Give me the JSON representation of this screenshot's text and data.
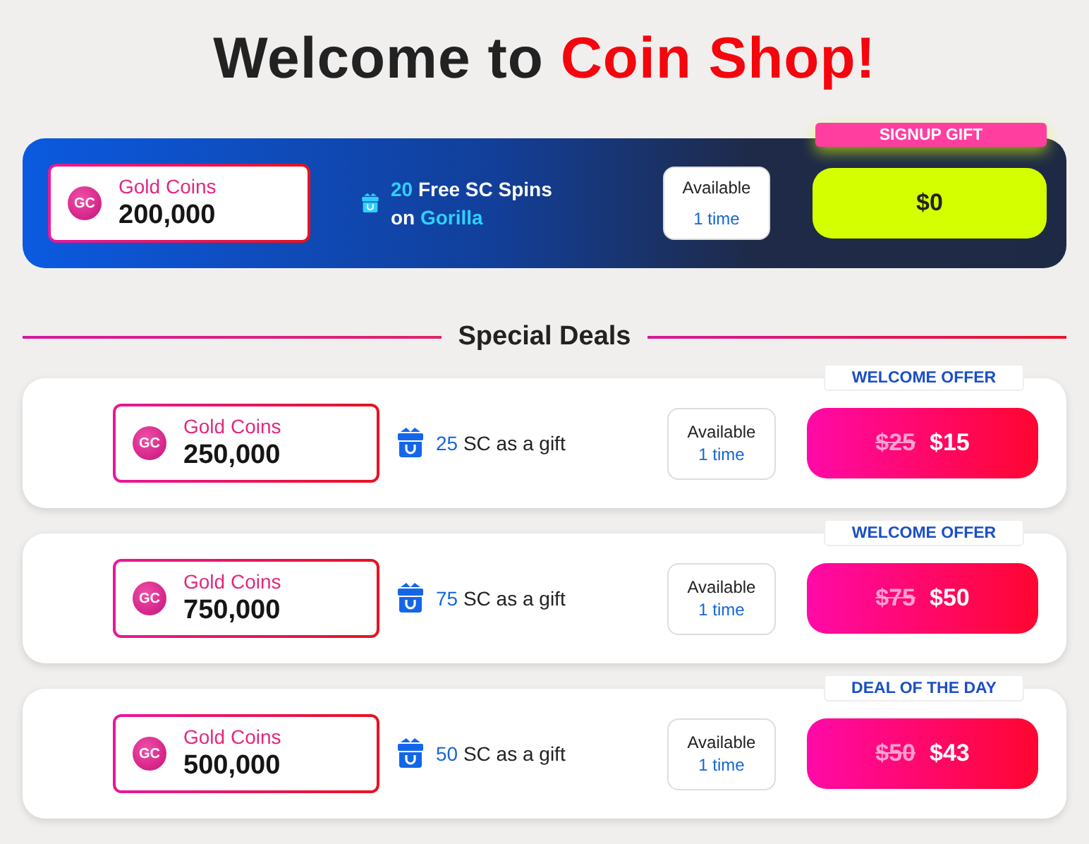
{
  "title": {
    "text": "Welcome to",
    "highlight": "Coin Shop!"
  },
  "signup": {
    "coin_badge": "GC",
    "coin_label": "Gold Coins",
    "amount": "200,000",
    "gift_amount": "20",
    "gift_text": "Free SC Spins",
    "gift_on": "on",
    "gift_game": "Gorilla",
    "available_label": "Available",
    "available_count": "1 time",
    "ribbon": "SIGNUP GIFT",
    "price": "$0"
  },
  "section_title": "Special Deals",
  "deals": [
    {
      "ribbon": "WELCOME OFFER",
      "coin_badge": "GC",
      "coin_label": "Gold Coins",
      "amount": "250,000",
      "gift_amount": "25",
      "gift_text": "SC as a gift",
      "available_label": "Available",
      "available_count": "1 time",
      "old_price": "$25",
      "price": "$15"
    },
    {
      "ribbon": "WELCOME OFFER",
      "coin_badge": "GC",
      "coin_label": "Gold Coins",
      "amount": "750,000",
      "gift_amount": "75",
      "gift_text": "SC as a gift",
      "available_label": "Available",
      "available_count": "1 time",
      "old_price": "$75",
      "price": "$50"
    },
    {
      "ribbon": "DEAL OF THE DAY",
      "coin_badge": "GC",
      "coin_label": "Gold Coins",
      "amount": "500,000",
      "gift_amount": "50",
      "gift_text": "SC as a gift",
      "available_label": "Available",
      "available_count": "1 time",
      "old_price": "$50",
      "price": "$43"
    }
  ]
}
